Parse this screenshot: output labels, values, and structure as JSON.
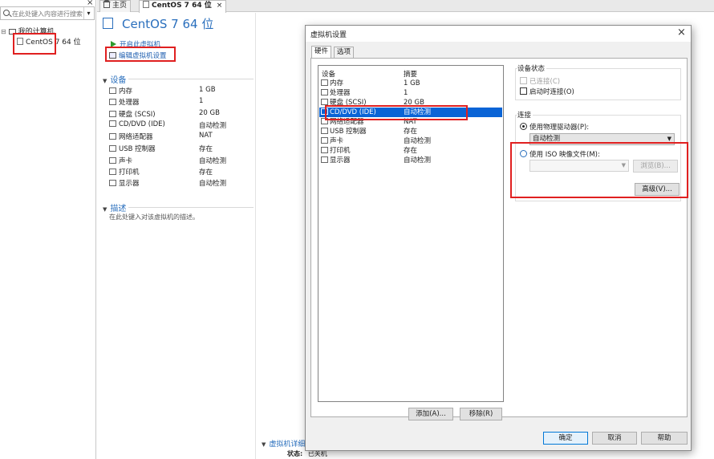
{
  "library": {
    "search_placeholder": "在此处键入内容进行搜索",
    "close_glyph": "×",
    "tree_root": "我的计算机",
    "vm_item": "CentOS 7 64 位"
  },
  "tabs": [
    {
      "label": "主页"
    },
    {
      "label": "CentOS 7 64 位",
      "close": "×"
    }
  ],
  "vm_page": {
    "title": "CentOS 7 64 位",
    "power_on_link": "开启此虚拟机",
    "edit_settings_link": "编辑虚拟机设置",
    "devices_section": "设备",
    "devices": [
      {
        "name": "内存",
        "value": "1 GB",
        "icon": "memory-icon"
      },
      {
        "name": "处理器",
        "value": "1",
        "icon": "cpu-icon"
      },
      {
        "name": "硬盘 (SCSI)",
        "value": "20 GB",
        "icon": "harddisk-icon"
      },
      {
        "name": "CD/DVD (IDE)",
        "value": "自动检测",
        "icon": "cdrom-icon"
      },
      {
        "name": "网络适配器",
        "value": "NAT",
        "icon": "network-icon"
      },
      {
        "name": "USB 控制器",
        "value": "存在",
        "icon": "usb-icon"
      },
      {
        "name": "声卡",
        "value": "自动检测",
        "icon": "sound-icon"
      },
      {
        "name": "打印机",
        "value": "存在",
        "icon": "printer-icon"
      },
      {
        "name": "显示器",
        "value": "自动检测",
        "icon": "display-icon"
      }
    ],
    "description_section": "描述",
    "description_placeholder": "在此处键入对该虚拟机的描述。",
    "details_section": "虚拟机详细",
    "status_label": "状态:",
    "status_value": "已关机"
  },
  "dialog": {
    "title": "虚拟机设置",
    "close_glyph": "×",
    "tabs": [
      "硬件",
      "选项"
    ],
    "list_header_device": "设备",
    "list_header_summary": "摘要",
    "hardware": [
      {
        "name": "内存",
        "summary": "1 GB"
      },
      {
        "name": "处理器",
        "summary": "1"
      },
      {
        "name": "硬盘 (SCSI)",
        "summary": "20 GB"
      },
      {
        "name": "CD/DVD (IDE)",
        "summary": "自动检测",
        "selected": true
      },
      {
        "name": "网络适配器",
        "summary": "NAT"
      },
      {
        "name": "USB 控制器",
        "summary": "存在"
      },
      {
        "name": "声卡",
        "summary": "自动检测"
      },
      {
        "name": "打印机",
        "summary": "存在"
      },
      {
        "name": "显示器",
        "summary": "自动检测"
      }
    ],
    "add_button": "添加(A)...",
    "remove_button": "移除(R)",
    "device_status_group": "设备状态",
    "connected_checkbox": "已连接(C)",
    "connect_at_power_on": "启动时连接(O)",
    "connection_group": "连接",
    "use_physical_drive": "使用物理驱动器(P):",
    "physical_drive_value": "自动检测",
    "use_iso": "使用 ISO 映像文件(M):",
    "iso_path": "",
    "browse_button": "浏览(B)...",
    "advanced_button": "高级(V)...",
    "ok_button": "确定",
    "cancel_button": "取消",
    "help_button": "帮助"
  },
  "colors": {
    "accent": "#2a6fbd",
    "selection": "#0a64d6",
    "highlight_box": "#e02020"
  }
}
